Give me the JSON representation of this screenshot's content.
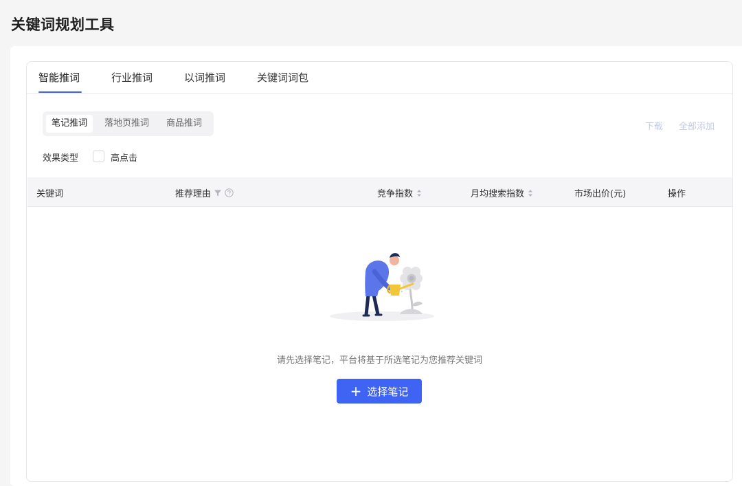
{
  "page": {
    "title": "关键词规划工具"
  },
  "tabs": [
    {
      "label": "智能推词",
      "active": true
    },
    {
      "label": "行业推词"
    },
    {
      "label": "以词推词"
    },
    {
      "label": "关键词词包"
    }
  ],
  "segments": [
    {
      "label": "笔记推词",
      "active": true
    },
    {
      "label": "落地页推词"
    },
    {
      "label": "商品推词"
    }
  ],
  "actions": {
    "download": "下载",
    "add_all": "全部添加"
  },
  "filter": {
    "label": "效果类型",
    "option": "高点击",
    "checked": false
  },
  "table": {
    "columns": [
      "关键词",
      "推荐理由",
      "竞争指数",
      "月均搜索指数",
      "市场出价(元)",
      "操作"
    ]
  },
  "empty": {
    "message": "请先选择笔记，平台将基于所选笔记为您推荐关键词",
    "button_plus": "+",
    "button_label": "选择笔记"
  },
  "colors": {
    "accent": "#3f63f3",
    "disabled_link": "#c5cbe4",
    "illustration_figure": "#5b76e8",
    "illustration_can": "#f3c53a"
  },
  "icons": {
    "filter": "filter-icon",
    "help": "question-circle-icon",
    "sort": "sort-icon",
    "add": "plus-icon"
  }
}
